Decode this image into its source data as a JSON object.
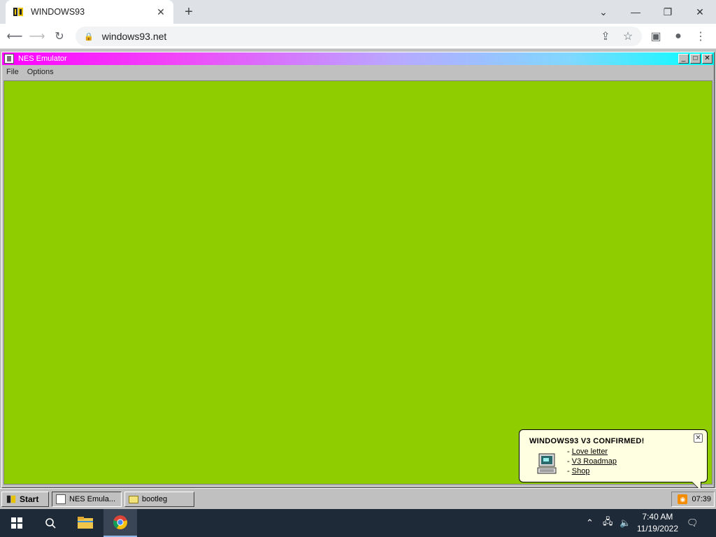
{
  "browser": {
    "tab_title": "WINDOWS93",
    "tab_close": "✕",
    "new_tab": "+",
    "url": "windows93.net"
  },
  "app": {
    "title": "NES Emulator",
    "menu": [
      "File",
      "Options"
    ],
    "screen_color": "#8fcc00"
  },
  "notification": {
    "title": "WINDOWS93 V3 CONFIRMED!",
    "close": "✕",
    "links": [
      "Love letter",
      "V3 Roadmap",
      "Shop"
    ]
  },
  "w93_taskbar": {
    "start": "Start",
    "items": [
      "NES Emula...",
      "bootleg"
    ],
    "clock": "07:39"
  },
  "win_taskbar": {
    "time": "7:40 AM",
    "date": "11/19/2022"
  },
  "colors": {
    "title_gradient_start": "#ff00ff",
    "title_gradient_end": "#00ffff",
    "desktop": "#c0c0c0"
  }
}
